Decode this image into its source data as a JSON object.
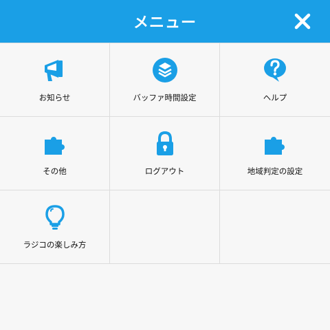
{
  "header": {
    "title": "メニュー"
  },
  "menu": {
    "items": [
      {
        "label": "お知らせ",
        "icon": "megaphone-icon"
      },
      {
        "label": "バッファ時間設定",
        "icon": "layers-icon"
      },
      {
        "label": "ヘルプ",
        "icon": "question-bubble-icon"
      },
      {
        "label": "その他",
        "icon": "puzzle-icon"
      },
      {
        "label": "ログアウト",
        "icon": "lock-icon"
      },
      {
        "label": "地域判定の設定",
        "icon": "puzzle-icon"
      },
      {
        "label": "ラジコの楽しみ方",
        "icon": "lightbulb-icon"
      }
    ]
  },
  "colors": {
    "header": "#1a9fe6",
    "icon": "#1a9fe6",
    "background": "#f7f7f7",
    "divider": "#dcdcdc"
  }
}
